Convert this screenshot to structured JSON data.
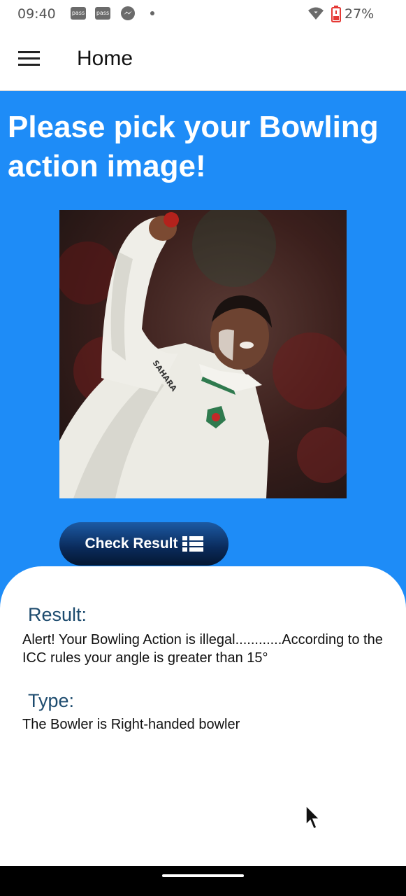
{
  "status_bar": {
    "time": "09:40",
    "notification_icons": [
      "pass-icon",
      "pass-icon",
      "messenger-icon",
      "dot-icon"
    ],
    "pass_label": "pass",
    "battery": "27%",
    "battery_color": "#e53935"
  },
  "app_bar": {
    "title": "Home",
    "menu_icon": "hamburger-menu-icon"
  },
  "main": {
    "background_color": "#1e8cf7",
    "heading": "Please pick your Bowling action image!",
    "image_alt": "Bowler in white cricket uniform delivering a red ball",
    "check_button_label": "Check Result",
    "check_button_icon": "list-icon"
  },
  "result": {
    "result_label": "Result:",
    "result_text": "Alert! Your Bowling Action is illegal............According to the ICC rules your angle is greater than 15°",
    "type_label": "Type:",
    "type_text": "The Bowler is Right-handed bowler"
  }
}
